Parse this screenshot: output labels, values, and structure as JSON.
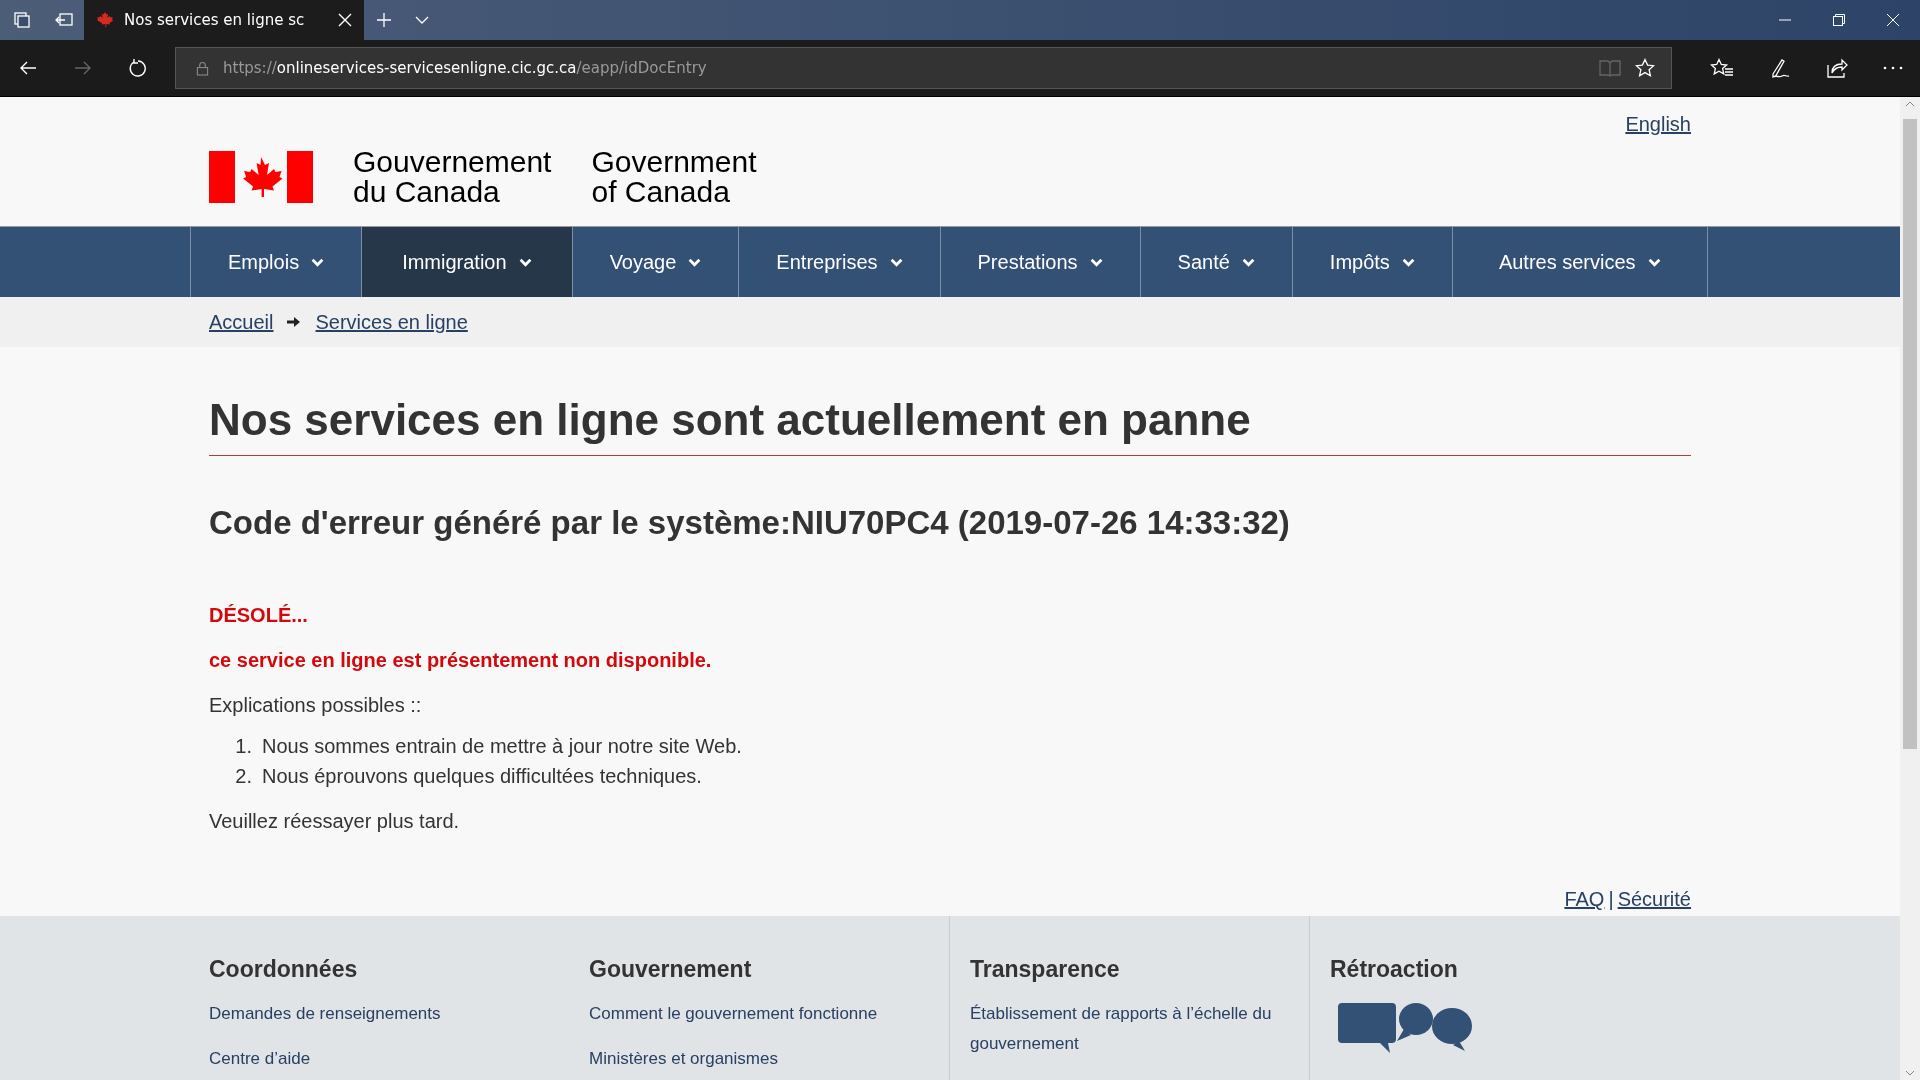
{
  "browser": {
    "tabs": [
      {
        "title": "Nos services en ligne sc",
        "selected": true
      }
    ],
    "url": {
      "scheme": "https://",
      "host": "onlineservices-servicesenligne.cic.gc.ca",
      "path": "/eapp/idDocEntry"
    }
  },
  "language_link": "English",
  "signature": {
    "french": [
      "Gouvernement",
      "du Canada"
    ],
    "english": [
      "Government",
      "of Canada"
    ]
  },
  "nav": [
    {
      "label": "Emplois",
      "selected": false
    },
    {
      "label": "Immigration",
      "selected": true
    },
    {
      "label": "Voyage",
      "selected": false
    },
    {
      "label": "Entreprises",
      "selected": false
    },
    {
      "label": "Prestations",
      "selected": false
    },
    {
      "label": "Santé",
      "selected": false
    },
    {
      "label": "Impôts",
      "selected": false
    },
    {
      "label": "Autres services",
      "selected": false
    }
  ],
  "breadcrumb": [
    "Accueil",
    "Services en ligne"
  ],
  "title": "Nos services en ligne sont actuellement en panne",
  "error_code": "Code d'erreur généré par le système:NIU70PC4 (2019-07-26 14:33:32)",
  "apology": "DÉSOLÉ...",
  "message": "ce service en ligne est présentement non disponible.",
  "explanations_label": "Explications possibles ::",
  "explanations": [
    {
      "number": "1.",
      "text": "Nous sommes entrain de mettre à jour notre site Web."
    },
    {
      "number": "2.",
      "text": "Nous éprouvons quelques difficultées techniques."
    }
  ],
  "retry": "Veuillez réessayer plus tard.",
  "footer_links": {
    "items": [
      "FAQ",
      "Sécurité"
    ],
    "separator": "|"
  },
  "footer_columns": [
    {
      "heading": "Coordonnées",
      "links": [
        "Demandes de renseignements",
        "Centre d’aide"
      ]
    },
    {
      "heading": "Gouvernement",
      "links": [
        "Comment le gouvernement fonctionne",
        "Ministères et organismes"
      ]
    },
    {
      "heading": "Transparence",
      "links": [
        "Établissement de rapports à l’échelle du gouvernement"
      ]
    },
    {
      "heading": "Rétroaction",
      "kind": "feedback"
    }
  ]
}
